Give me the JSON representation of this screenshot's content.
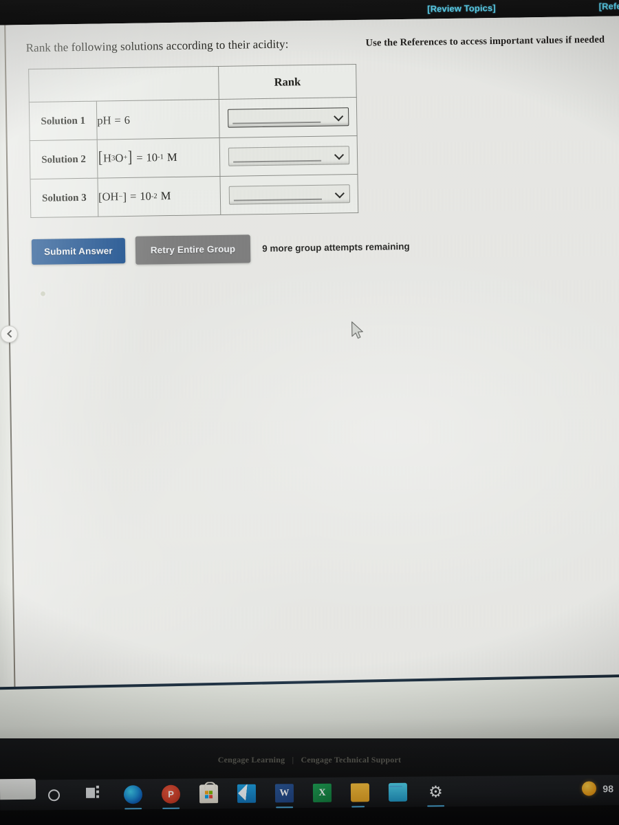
{
  "topbar": {
    "review_topics_label": "[Review Topics]",
    "references_label": "[Refer",
    "link_color": "#5fd8f5",
    "bar_color": "#141414"
  },
  "header": {
    "references_note": "Use the References to access important values if needed"
  },
  "question": {
    "prompt": "Rank the following solutions according to their acidity:"
  },
  "table": {
    "headers": {
      "blank": "",
      "rank": "Rank"
    },
    "rows": [
      {
        "label": "Solution 1",
        "expression_plain": "pH = 6",
        "expression_parts": {
          "open_bracket": "",
          "species": "pH",
          "close_bracket": "",
          "equals": "=",
          "base": "6",
          "exponent": "",
          "unit": ""
        },
        "rank_value": "",
        "rank_placeholder": "",
        "focused": true
      },
      {
        "label": "Solution 2",
        "expression_plain": "[H3O+] = 10-1 M",
        "expression_parts": {
          "open_bracket": "[",
          "species": "H",
          "species_sub": "3",
          "species_tail": "O",
          "species_sup": "+",
          "close_bracket": "]",
          "equals": "=",
          "base": "10",
          "exponent": "-1",
          "unit": "M"
        },
        "rank_value": "",
        "rank_placeholder": "",
        "focused": false
      },
      {
        "label": "Solution 3",
        "expression_plain": "[OH-] = 10-2 M",
        "expression_parts": {
          "open_bracket": "[",
          "species": "OH",
          "species_sup": "−",
          "close_bracket": "]",
          "equals": "=",
          "base": "10",
          "exponent": "-2",
          "unit": "M"
        },
        "rank_value": "",
        "rank_placeholder": "",
        "focused": false
      }
    ]
  },
  "actions": {
    "submit_label": "Submit Answer",
    "submit_color": "#1d5190",
    "retry_label": "Retry Entire Group",
    "retry_color": "#7f7f7f",
    "attempts_text": "9 more group attempts remaining"
  },
  "rail": {
    "collapse_label": "‹"
  },
  "footer": {
    "cengage_learning": "Cengage Learning",
    "separator": "|",
    "technical_support": "Cengage Technical Support"
  },
  "taskbar": {
    "icons": [
      {
        "name": "cortana-icon",
        "label": ""
      },
      {
        "name": "task-view-icon",
        "label": ""
      },
      {
        "name": "edge-icon",
        "label": ""
      },
      {
        "name": "powerpoint-icon",
        "label": "P"
      },
      {
        "name": "microsoft-store-icon",
        "label": ""
      },
      {
        "name": "mail-icon",
        "label": ""
      },
      {
        "name": "word-icon",
        "label": "W"
      },
      {
        "name": "excel-icon",
        "label": "X"
      },
      {
        "name": "file-explorer-icon",
        "label": ""
      },
      {
        "name": "calculator-icon",
        "label": ""
      },
      {
        "name": "settings-gear-icon",
        "label": "⚙"
      }
    ],
    "tray": {
      "battery_percent": "98",
      "indicator_color": "#f0a11a"
    }
  }
}
